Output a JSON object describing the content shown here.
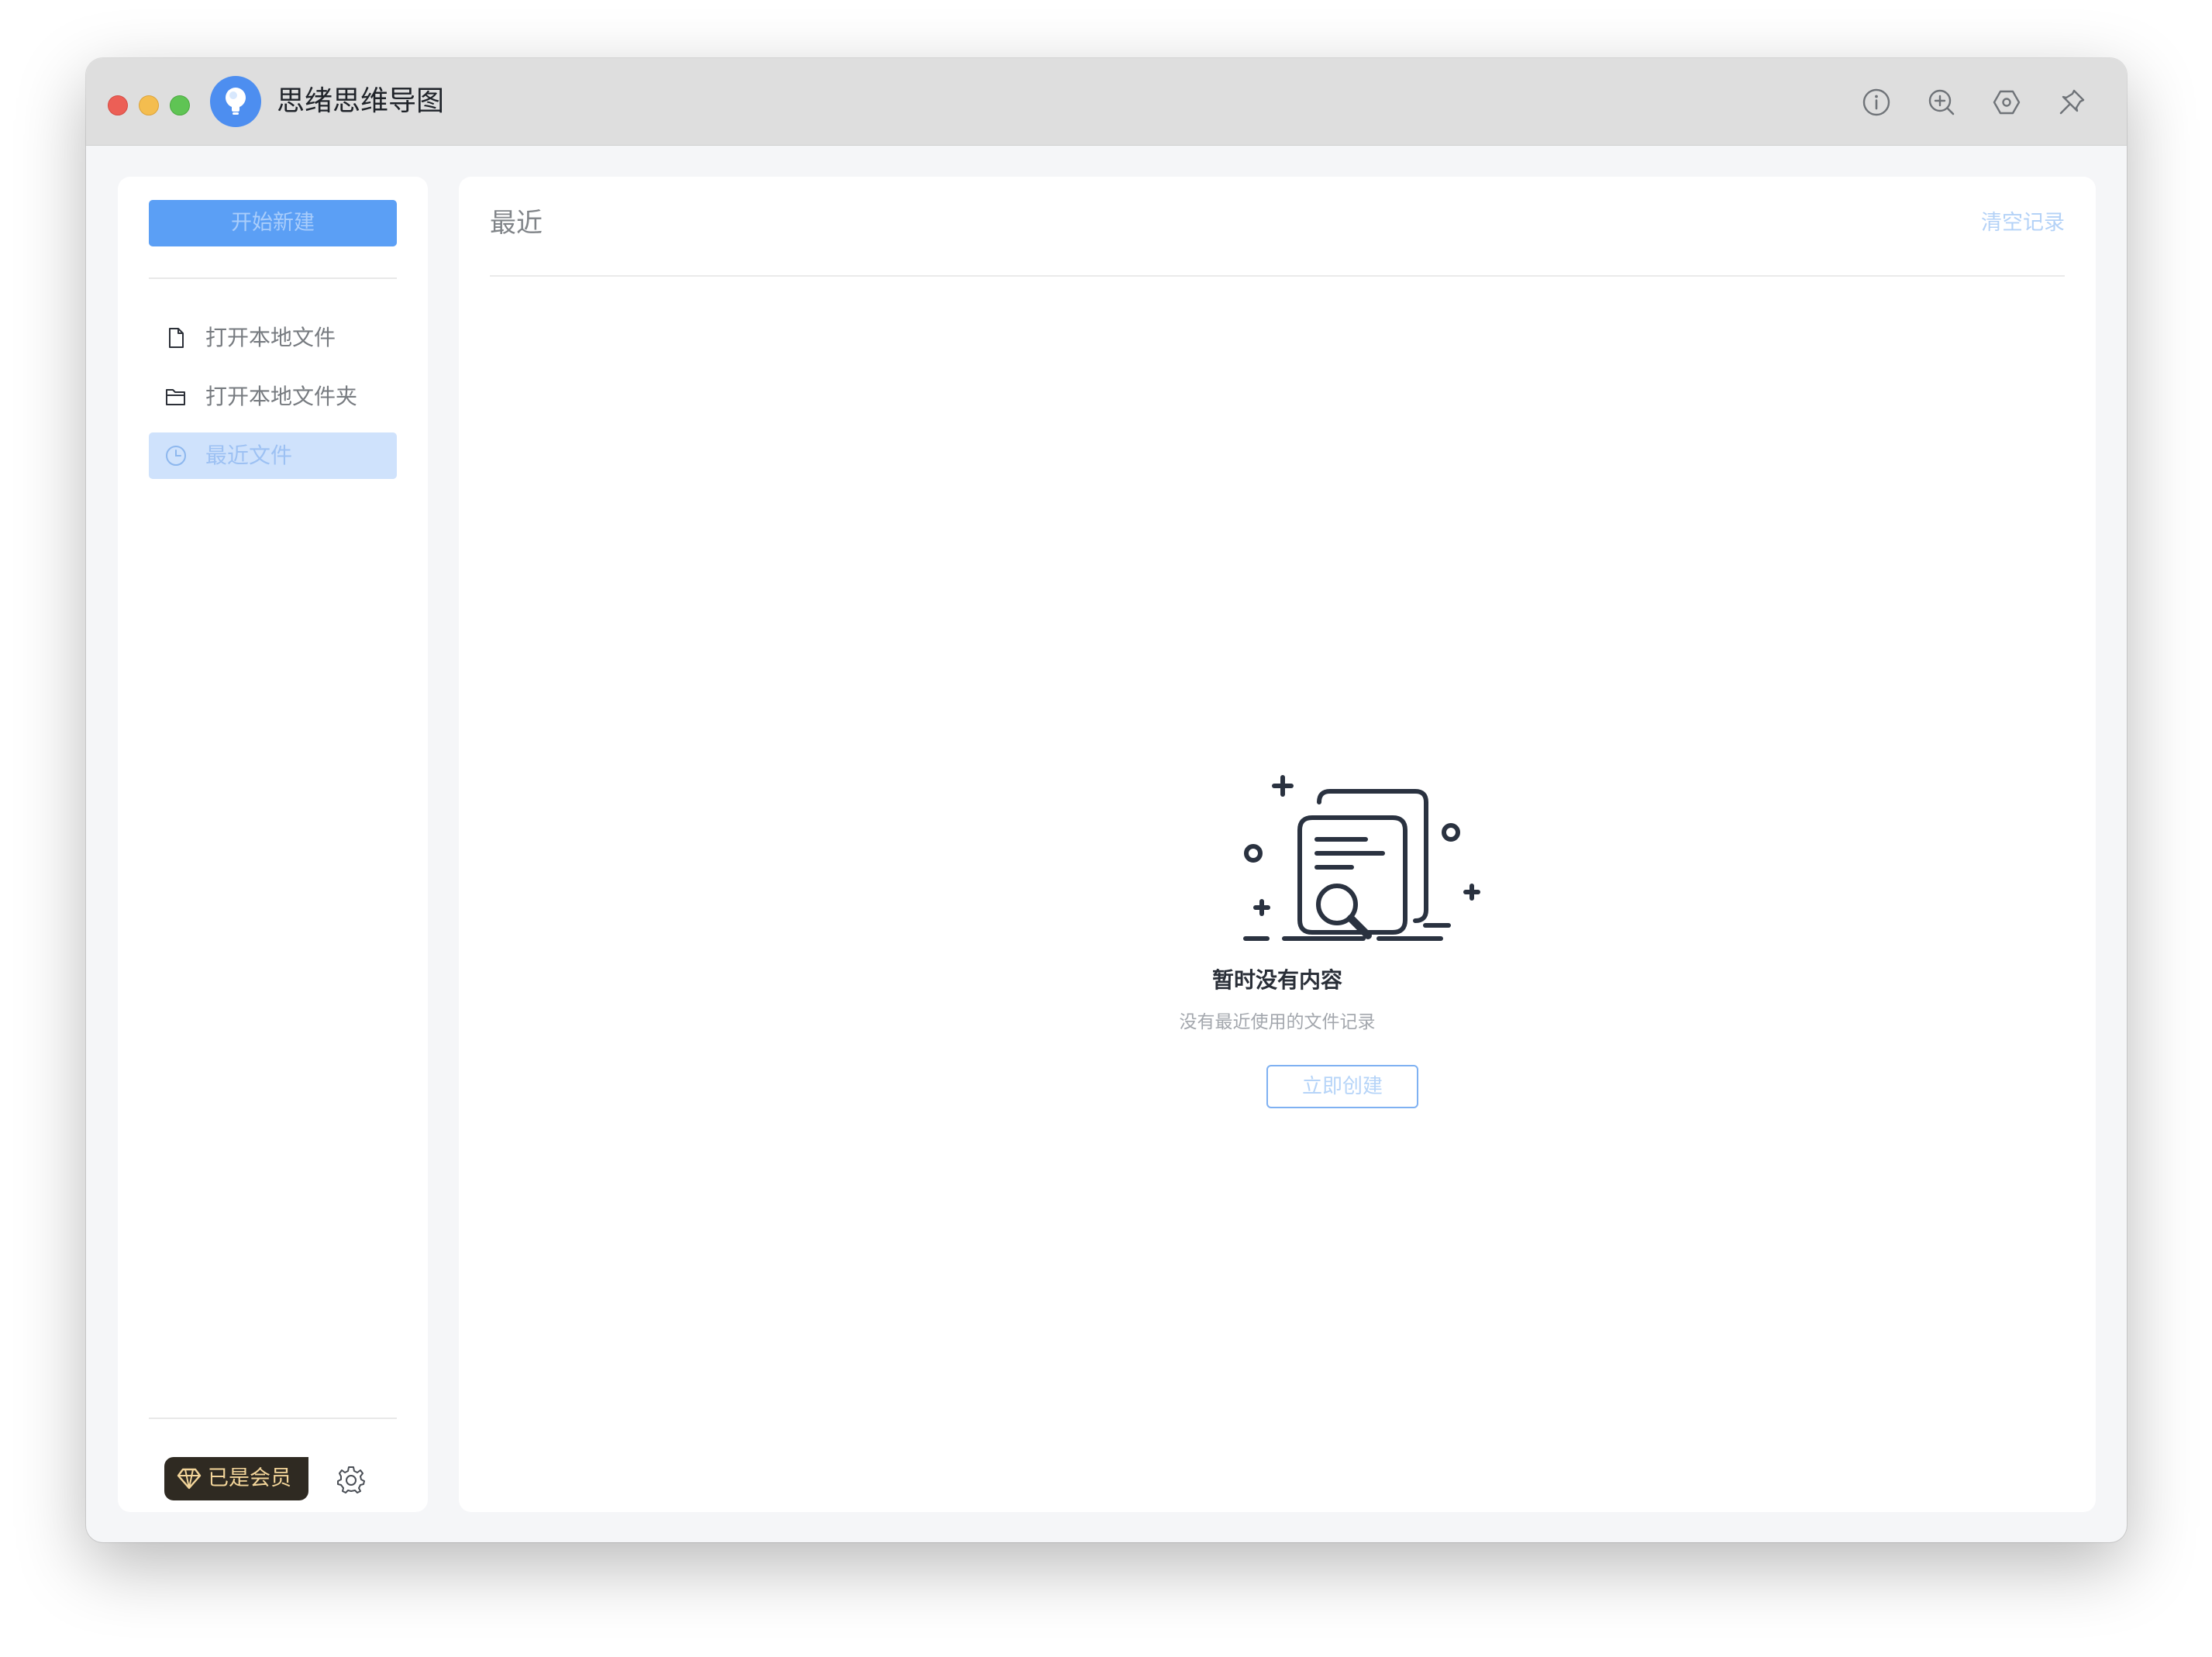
{
  "window": {
    "app_title": "思绪思维导图",
    "logo_icon": "lightbulb-logo-icon",
    "toolbar_icons": [
      "info-icon",
      "zoom-in-icon",
      "hexagon-settings-icon",
      "pin-icon"
    ]
  },
  "sidebar": {
    "new_button_label": "开始新建",
    "items": [
      {
        "label": "打开本地文件",
        "icon": "file-icon",
        "active": false
      },
      {
        "label": "打开本地文件夹",
        "icon": "folder-icon",
        "active": false
      },
      {
        "label": "最近文件",
        "icon": "clock-icon",
        "active": true
      }
    ],
    "member_badge_label": "已是会员",
    "member_badge_icon": "diamond-icon",
    "settings_icon": "gear-icon"
  },
  "main": {
    "title": "最近",
    "clear_link": "清空记录",
    "empty_state": {
      "illustration_icon": "empty-documents-search-icon",
      "title": "暂时没有内容",
      "subtitle": "没有最近使用的文件记录",
      "button_label": "立即创建"
    }
  },
  "colors": {
    "accent": "#5b9ff5",
    "accent_light": "#cfe2fc",
    "member_badge_bg": "#2f2a22",
    "member_badge_text": "#f3d59a"
  }
}
